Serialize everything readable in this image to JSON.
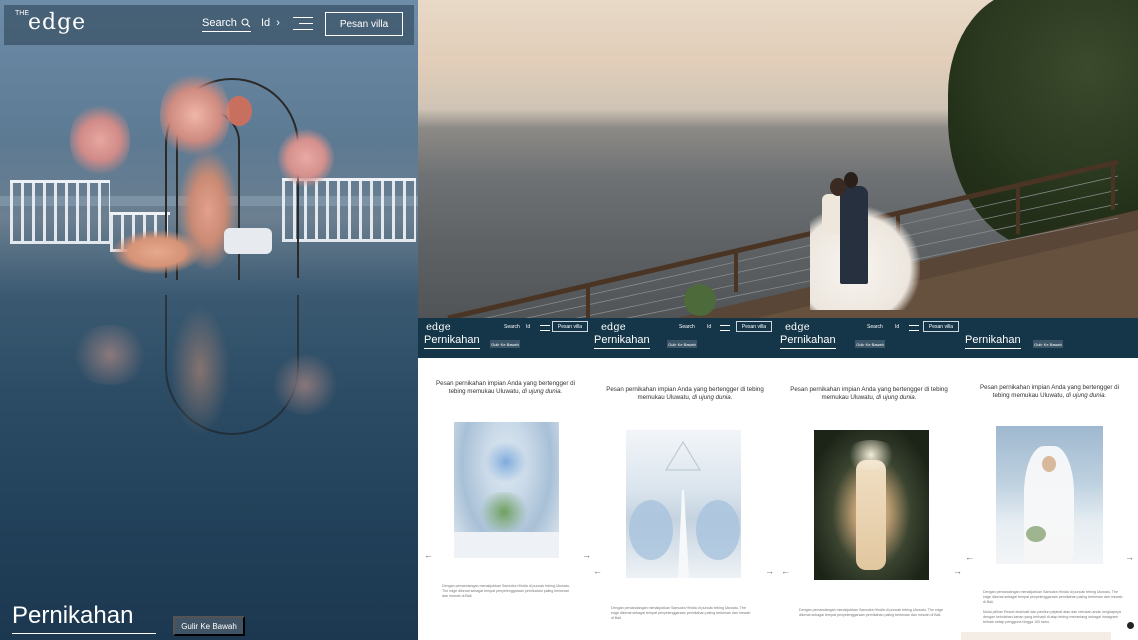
{
  "header": {
    "logo_the": "THE",
    "logo_word": "edge",
    "search_label": "Search",
    "lang_label": "Id",
    "book_villa_label": "Pesan villa"
  },
  "hero": {
    "title": "Pernikahan",
    "scroll_label": "Gulir Ke Bawah"
  },
  "panels": [
    {
      "logo": "edge",
      "search_label": "Search",
      "lang_label": "Id",
      "book_villa_label": "Pesan villa",
      "title": "Pernikahan",
      "scroll_label": "Gulir Ke Bawah",
      "intro_main": "Pesan pernikahan impian Anda yang bertengger di tebing memukau Uluwatu,",
      "intro_em": "di ujung dunia.",
      "image_icon": "table-setting-photo",
      "body_text": "Dengan pemandangan menakjubkan Samudra Hindia di puncak tebing Uluwatu, The edge dikenal sebagai tempat penyelenggaraan pernikahan paling berkesan dan mewah di Bali."
    },
    {
      "logo": "edge",
      "search_label": "Search",
      "lang_label": "Id",
      "book_villa_label": "Pesan villa",
      "title": "Pernikahan",
      "scroll_label": "Gulir Ke Bawah",
      "intro_main": "Pesan pernikahan impian Anda yang bertengger di tebing memukau Uluwatu,",
      "intro_em": "di ujung dunia.",
      "image_icon": "aisle-ceremony-photo",
      "body_text": "Dengan pemandangan menakjubkan Samudra Hindia di puncak tebing Uluwatu, The edge dikenal sebagai tempat penyelenggaraan pernikahan paling berkesan dan mewah di Bali."
    },
    {
      "logo": "edge",
      "search_label": "Search",
      "lang_label": "Id",
      "book_villa_label": "Pesan villa",
      "title": "Pernikahan",
      "scroll_label": "Gulir Ke Bawah",
      "intro_main": "Pesan pernikahan impian Anda yang bertengger di tebing memukau Uluwatu,",
      "intro_em": "di ujung dunia.",
      "image_icon": "wedding-cake-photo",
      "body_text": "Dengan pemandangan menakjubkan Samudra Hindia di puncak tebing Uluwatu, The edge dikenal sebagai tempat penyelenggaraan pernikahan paling berkesan dan mewah di Bali."
    },
    {
      "title": "Pernikahan",
      "scroll_label": "Gulir Ke Bawah",
      "intro_main": "Pesan pernikahan impian Anda yang bertengger di tebing memukau Uluwatu,",
      "intro_em": "di ujung dunia.",
      "image_icon": "bride-veil-photo",
      "body_text": "Dengan pemandangan menakjubkan Samudra Hindia di puncak tebing Uluwatu, The edge dikenal sebagai tempat penyelenggaraan pernikahan paling berkesan dan mewah di Bali.",
      "body_text_2": "Mulai pilihan Resort eksklusif dan paviliun pejabat atau dan retrusan anda, lengkapnya dengan keindahan kanan yang berhasil di atap tebing menantang sebagai Instagram terbaik setiap pengguna hingga 100 tamu."
    }
  ],
  "icons": {
    "search": "search-icon",
    "chevron": "chevron-right-icon",
    "menu": "hamburger-icon",
    "arrow_left": "arrow-left-icon",
    "arrow_right": "arrow-right-icon"
  },
  "colors": {
    "brand_navy": "#153649",
    "hero_sea": "#2d4d66"
  }
}
